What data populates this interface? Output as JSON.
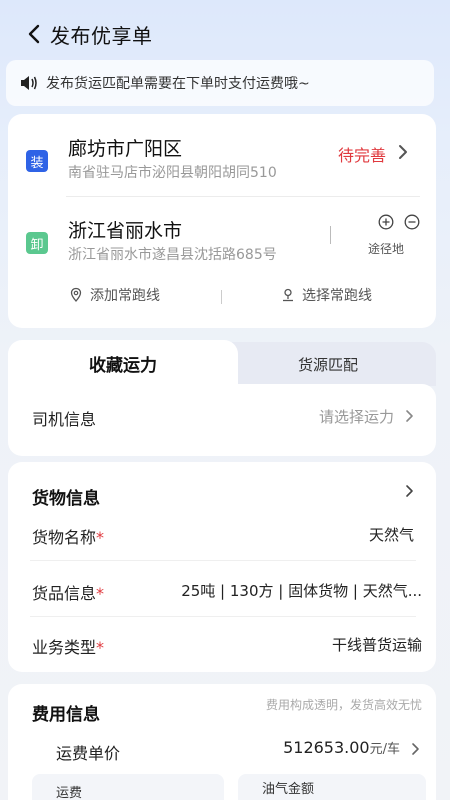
{
  "header": {
    "title": "发布优享单"
  },
  "notice": {
    "text": "发布货运匹配单需要在下单时支付运费哦~"
  },
  "route": {
    "load": {
      "badge": "装",
      "city": "廊坊市广阳区",
      "address": "南省驻马店市泌阳县朝阳胡同510",
      "status": "待完善"
    },
    "unload": {
      "badge": "卸",
      "city": "浙江省丽水市",
      "address": "浙江省丽水市遂昌县沈括路685号"
    },
    "via_label": "途径地",
    "actions": {
      "add_route": "添加常跑线",
      "choose_route": "选择常跑线"
    }
  },
  "tabs": {
    "active": "收藏运力",
    "inactive": "货源匹配"
  },
  "driver": {
    "label": "司机信息",
    "placeholder": "请选择运力"
  },
  "goods": {
    "title": "货物信息",
    "rows": [
      {
        "label": "货物名称",
        "required": "*",
        "value": "天然气"
      },
      {
        "label": "货品信息",
        "required": "*",
        "value": "25吨 | 130方 | 固体货物 | 天然气..."
      },
      {
        "label": "业务类型",
        "required": "*",
        "value": "干线普货运输"
      }
    ]
  },
  "fee": {
    "title": "费用信息",
    "hint": "费用构成透明，发货高效无忧",
    "unit_price_label": "运费单价",
    "unit_price_value": "512653.00",
    "unit_price_unit": "元/车",
    "freight_label": "运费",
    "oil_label": "油气金额"
  },
  "colors": {
    "accent_red": "#e0393e",
    "load_badge": "#2f63e6",
    "unload_badge": "#5bc88f"
  }
}
